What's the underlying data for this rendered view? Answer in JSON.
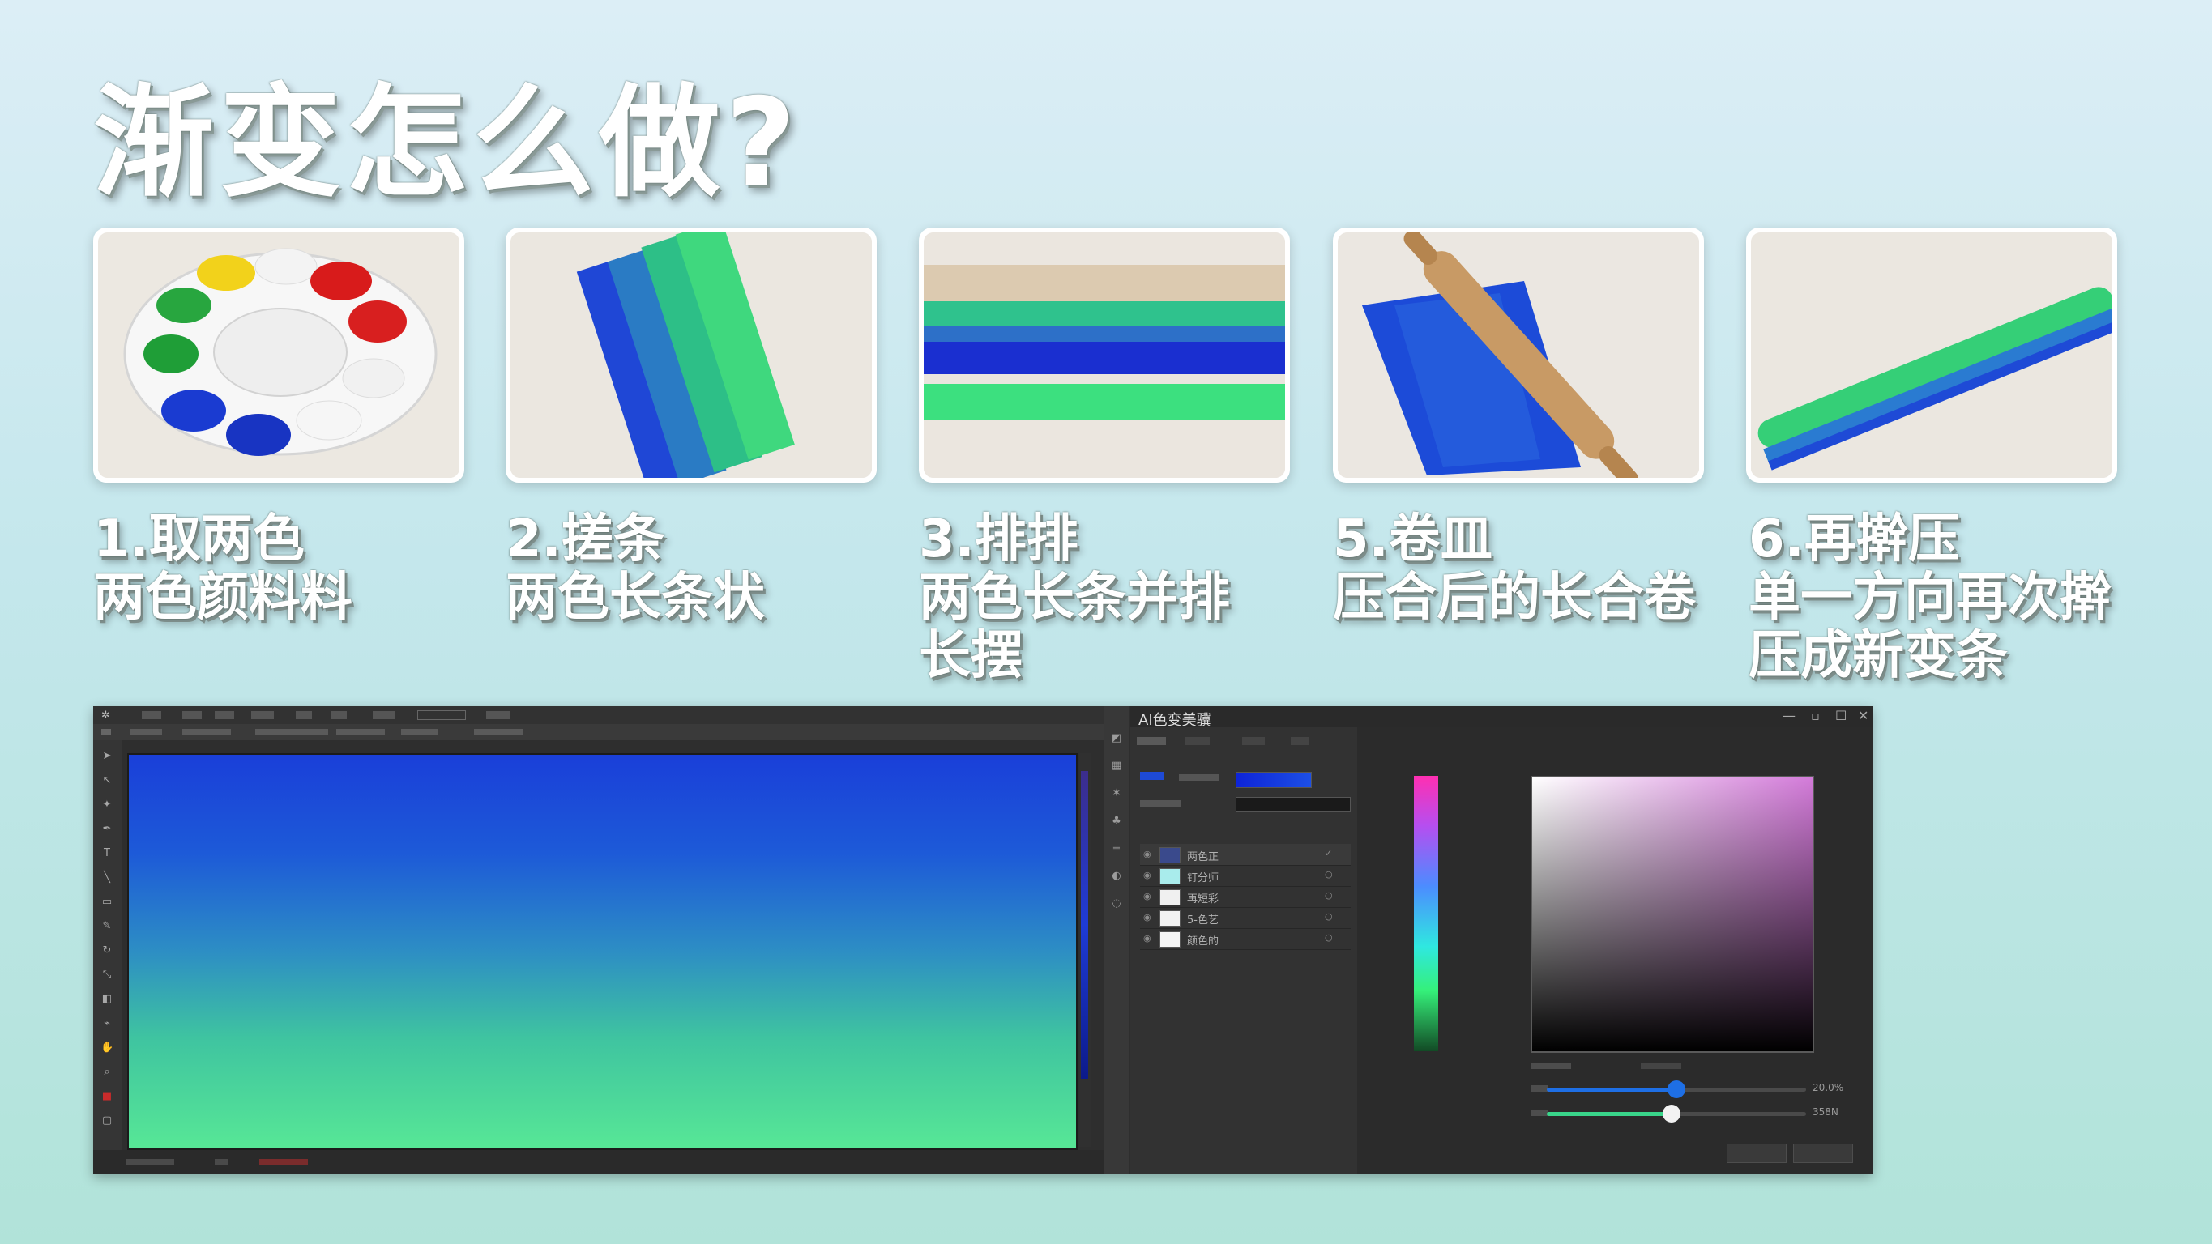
{
  "title": "渐变怎么做?",
  "steps": [
    {
      "line1": "1.取两色",
      "line2": "两色颜料料",
      "line3": ""
    },
    {
      "line1": "2.搓条",
      "line2": "两色长条状",
      "line3": ""
    },
    {
      "line1": "3.排排",
      "line2": "两色长条并排",
      "line3": "长摆"
    },
    {
      "line1": "5.卷皿",
      "line2": "压合后的长合卷",
      "line3": ""
    },
    {
      "line1": "6.再擀压",
      "line2": "单一方向再次擀",
      "line3": "压成新变条"
    }
  ],
  "app": {
    "panel_title": "AI色变美骥",
    "layers": [
      {
        "name": "两色正",
        "swatch": "#3a4a8c"
      },
      {
        "name": "钉分师",
        "swatch": "#a9ecec"
      },
      {
        "name": "再短彩",
        "swatch": "#f0f0f0"
      },
      {
        "name": "5-色艺",
        "swatch": "#f2f2f2"
      },
      {
        "name": "颜色的",
        "swatch": "#f5f5f5"
      }
    ],
    "slider1_value": "20.0%",
    "slider2_value": "358N",
    "slider1_level": 0.5,
    "slider2_level": 0.48
  },
  "colors": {
    "gradient_top": "#1a3fd9",
    "gradient_bottom": "#57e796",
    "blue": "#1e6fe5",
    "green": "#39d58a"
  }
}
